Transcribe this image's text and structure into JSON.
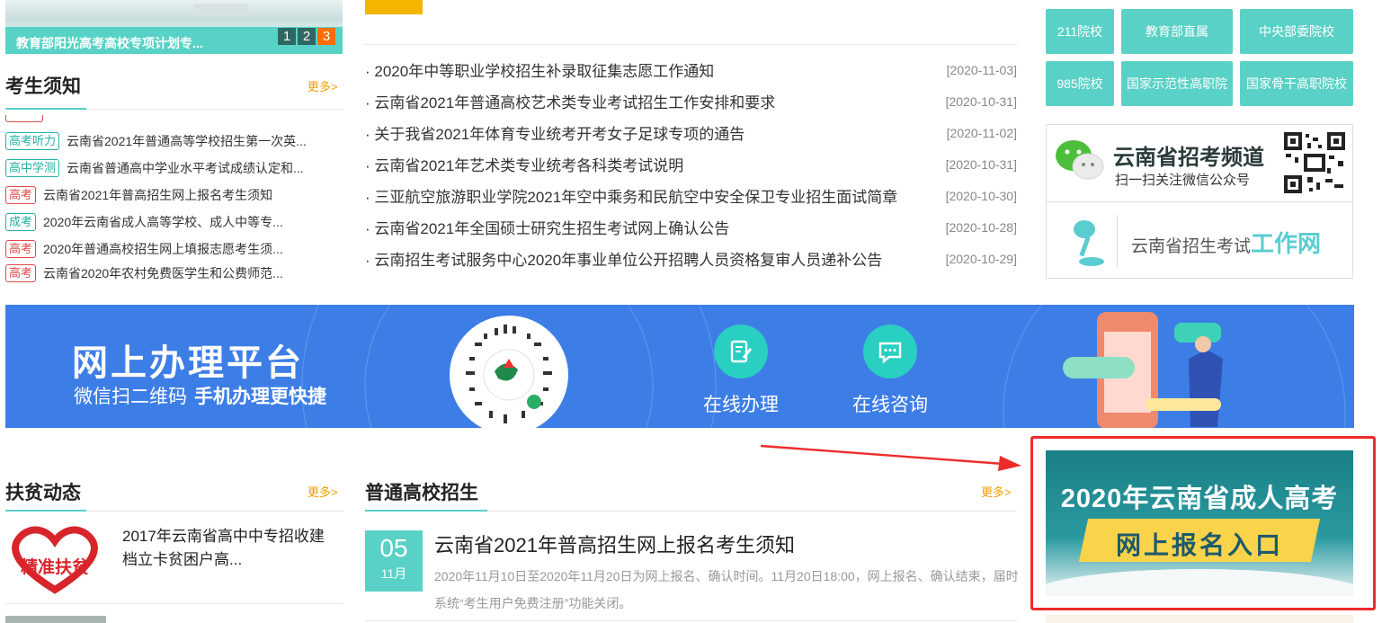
{
  "slider": {
    "caption": "教育部阳光高考高校专项计划专...",
    "pages": [
      "1",
      "2",
      "3"
    ],
    "active_page": 3
  },
  "notice_section": {
    "title": "考生须知",
    "more": "更多>",
    "items": [
      {
        "tag": "高考听力",
        "tag_color": "teal",
        "text": "云南省2021年普通高等学校招生第一次英..."
      },
      {
        "tag": "高中学测",
        "tag_color": "teal",
        "text": "云南省普通高中学业水平考试成绩认定和..."
      },
      {
        "tag": "高考",
        "tag_color": "red",
        "text": "云南省2021年普高招生网上报名考生须知"
      },
      {
        "tag": "成考",
        "tag_color": "teal",
        "text": "2020年云南省成人高等学校、成人中等专..."
      },
      {
        "tag": "高考",
        "tag_color": "red",
        "text": "2020年普通高校招生网上填报志愿考生须..."
      },
      {
        "tag": "高考",
        "tag_color": "red",
        "text": "云南省2020年农村免费医学生和公费师范..."
      }
    ]
  },
  "news": {
    "items": [
      {
        "title": "· 2020年中等职业学校招生补录取征集志愿工作通知",
        "date": "[2020-11-03]"
      },
      {
        "title": "· 云南省2021年普通高校艺术类专业考试招生工作安排和要求",
        "date": "[2020-10-31]"
      },
      {
        "title": "· 关于我省2021年体育专业统考开考女子足球专项的通告",
        "date": "[2020-11-02]"
      },
      {
        "title": "· 云南省2021年艺术类专业统考各科类考试说明",
        "date": "[2020-10-31]"
      },
      {
        "title": "· 三亚航空旅游职业学院2021年空中乘务和民航空中安全保卫专业招生面试简章",
        "date": "[2020-10-30]"
      },
      {
        "title": "· 云南省2021年全国硕士研究生招生考试网上确认公告",
        "date": "[2020-10-28]"
      },
      {
        "title": "· 云南招生考试服务中心2020年事业单位公开招聘人员资格复审人员递补公告",
        "date": "[2020-10-29]"
      }
    ]
  },
  "school_tags": [
    "211院校",
    "教育部直属",
    "中央部委院校",
    "985院校",
    "国家示范性高职院",
    "国家骨干高职院校"
  ],
  "wechat": {
    "title": "云南省招考频道",
    "subtitle": "扫一扫关注微信公众号",
    "work_prefix": "云南省招生考试",
    "work_emph": "工作网"
  },
  "banner": {
    "title": "网上办理平台",
    "sub_a": "微信扫二维码",
    "sub_b": "手机办理更快捷",
    "feature_online": "在线办理",
    "feature_consult": "在线咨询"
  },
  "poverty": {
    "title": "扶贫动态",
    "more": "更多>",
    "logo_text": "精准扶贫",
    "item_text_1": "2017年云南省高中中专招收建",
    "item_text_2": "档立卡贫困户高..."
  },
  "general": {
    "title": "普通高校招生",
    "more": "更多>",
    "day": "05",
    "month": "11月",
    "article_title": "云南省2021年普高招生网上报名考生须知",
    "summary": "2020年11月10日至2020年11月20日为网上报名、确认时间。11月20日18:00，网上报名、确认结束，届时系统“考生用户免费注册”功能关闭。"
  },
  "cta": {
    "title": "2020年云南省成人高考",
    "ribbon": "网上报名入口"
  },
  "colors": {
    "teal": "#5ad1c6",
    "orange": "#f0a000",
    "banner_blue": "#3d7ee6",
    "annotation_red": "#ee2b2b"
  }
}
